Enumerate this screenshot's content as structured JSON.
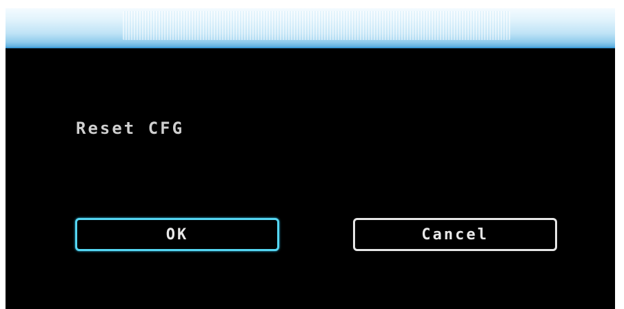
{
  "dialog": {
    "message": "Reset CFG",
    "buttons": {
      "ok_label": "OK",
      "cancel_label": "Cancel"
    },
    "focused_button": "OK"
  },
  "colors": {
    "background": "#000000",
    "title_bar": "#bfe3f6",
    "text": "#cfcfcf",
    "focus_border": "#55d6f2",
    "button_border": "#e6e6e6"
  }
}
